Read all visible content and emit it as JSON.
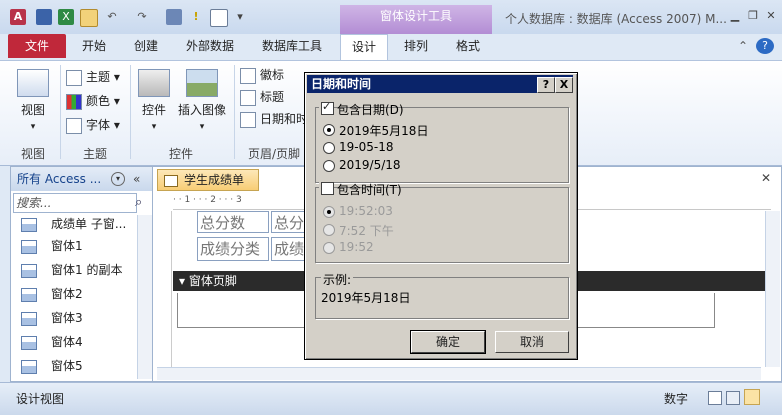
{
  "app_title": "个人数据库 : 数据库 (Access 2007) M...",
  "context_tab_header": "窗体设计工具",
  "tabs": [
    "文件",
    "开始",
    "创建",
    "外部数据",
    "数据库工具",
    "设计",
    "排列",
    "格式"
  ],
  "ribbon": {
    "groups": {
      "views": "视图",
      "themes": "主题",
      "controls": "控件",
      "header_footer": "页眉/页脚"
    },
    "view_button": "视图",
    "theme_button": "主题",
    "color_button": "颜色",
    "font_button": "字体",
    "controls_button": "控件",
    "insert_image_button": "插入图像",
    "logo_button": "徽标",
    "title_button": "标题",
    "datetime_button": "日期和时"
  },
  "nav": {
    "header": "所有 Access ...",
    "search_placeholder": "搜索...",
    "items": [
      "成绩单 子窗...",
      "窗体1",
      "窗体1 的副本",
      "窗体2",
      "窗体3",
      "窗体4",
      "窗体5"
    ]
  },
  "document": {
    "tab_label": "学生成绩单",
    "fields": [
      "总分数",
      "总分",
      "成绩分类",
      "成绩"
    ],
    "footer_band": "窗体页脚",
    "ruler": "· · 1 · · · 2 · · · 3"
  },
  "status": {
    "left": "设计视图",
    "mode": "数字"
  },
  "dialog": {
    "title": "日期和时间",
    "include_date_label": "包含日期(D)",
    "include_date_checked": true,
    "date_formats": [
      "2019年5月18日",
      "19-05-18",
      "2019/5/18"
    ],
    "date_selected_index": 0,
    "include_time_label": "包含时间(T)",
    "include_time_checked": false,
    "time_formats": [
      "19:52:03",
      "7:52 下午",
      "19:52"
    ],
    "time_selected_index": 0,
    "example_label": "示例:",
    "example_value": "2019年5月18日",
    "ok_label": "确定",
    "cancel_label": "取消",
    "help_label": "?",
    "close_label": "X"
  }
}
